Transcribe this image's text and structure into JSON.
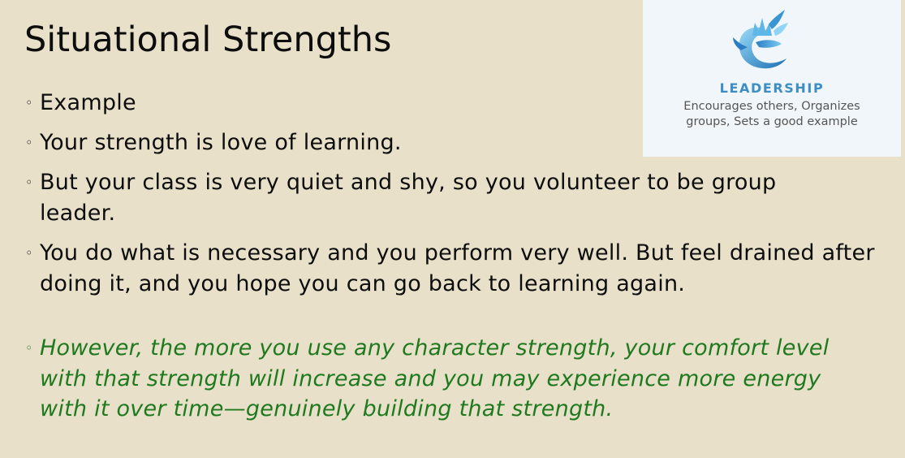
{
  "slide": {
    "title": "Situational Strengths"
  },
  "bullets": [
    {
      "marker": "◦",
      "text": "Example"
    },
    {
      "marker": "◦",
      "text": "Your strength is love of learning."
    },
    {
      "marker": "◦",
      "text": "But your class is very quiet and shy, so you volunteer to be group leader."
    },
    {
      "marker": "◦",
      "text": "You do what is necessary and you perform very well. But feel drained after doing it, and you hope you can go back to learning again."
    },
    {
      "marker": "◦",
      "text": "However, the more you use any character strength, your comfort level with that strength will increase and you may experience more energy with it over time—genuinely building that strength."
    }
  ],
  "leadership_card": {
    "heading": "LEADERSHIP",
    "description_line1": "Encourages others, Organizes",
    "description_line2": "groups, Sets a good example",
    "icon": "leadership-crown-icon",
    "colors": {
      "heading": "#3d8ec2",
      "icon_light": "#8fd3f5",
      "icon_dark": "#1d6fb3",
      "card_bg": "#f1f6fa"
    }
  },
  "colors": {
    "background": "#e8e0c9",
    "text": "#0d0d0d",
    "emphasis": "#1f7a1f"
  }
}
